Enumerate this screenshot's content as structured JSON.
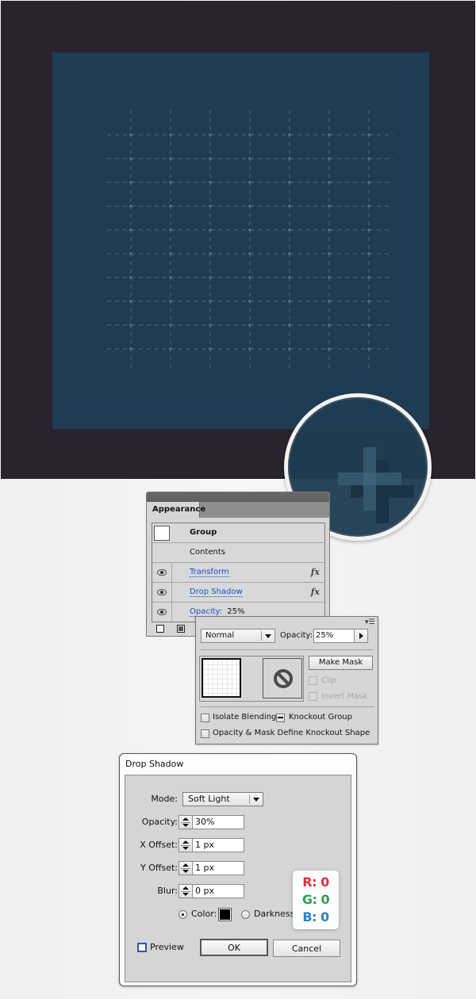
{
  "canvas": {
    "background_color": "#28232e",
    "artboard_color": "#1f3c52",
    "grid_line_color": "#4d6d82",
    "grid_cross_color": "#6a8799",
    "grid_columns": 7,
    "grid_rows": 10
  },
  "magnifier": {
    "icon": "zoom-magnifier",
    "content": "plus-shape-with-shadow",
    "shape_color": "#3a5f73",
    "shadow_color": "#1a3345"
  },
  "appearance_panel": {
    "tab_label": "Appearance",
    "rows": [
      {
        "label": "Group",
        "bold": true,
        "has_thumb": true
      },
      {
        "label": "Contents"
      },
      {
        "label": "Transform",
        "link": true,
        "eye": true,
        "fx": true
      },
      {
        "label": "Drop Shadow",
        "link": true,
        "eye": true,
        "fx": true
      },
      {
        "label": "Opacity:",
        "value": "25%",
        "link": true,
        "eye": true
      }
    ],
    "fx_label": "fx",
    "footer_icons": [
      "new-stroke-icon",
      "new-fill-icon"
    ]
  },
  "transparency_panel": {
    "blend_mode": "Normal",
    "opacity_label": "Opacity:",
    "opacity_value": "25%",
    "make_mask_label": "Make Mask",
    "clip_label": "Clip",
    "invert_mask_label": "Invert Mask",
    "isolate_blending_label": "Isolate Blending",
    "knockout_group_label": "Knockout Group",
    "define_knockout_label": "Opacity & Mask Define Knockout Shape"
  },
  "drop_shadow_dialog": {
    "title": "Drop Shadow",
    "mode_label": "Mode:",
    "mode_value": "Soft Light",
    "opacity_label": "Opacity:",
    "opacity_value": "30%",
    "x_offset_label": "X Offset:",
    "x_offset_value": "1 px",
    "y_offset_label": "Y Offset:",
    "y_offset_value": "1 px",
    "blur_label": "Blur:",
    "blur_value": "0 px",
    "color_label": "Color:",
    "color_value": "#000000",
    "darkness_label": "Darkness",
    "preview_label": "Preview",
    "ok_label": "OK",
    "cancel_label": "Cancel"
  },
  "rgb_callout": {
    "r": "R: 0",
    "g": "G: 0",
    "b": "B: 0",
    "r_color": "#e0313c",
    "g_color": "#2ea04e",
    "b_color": "#2f84c0"
  }
}
